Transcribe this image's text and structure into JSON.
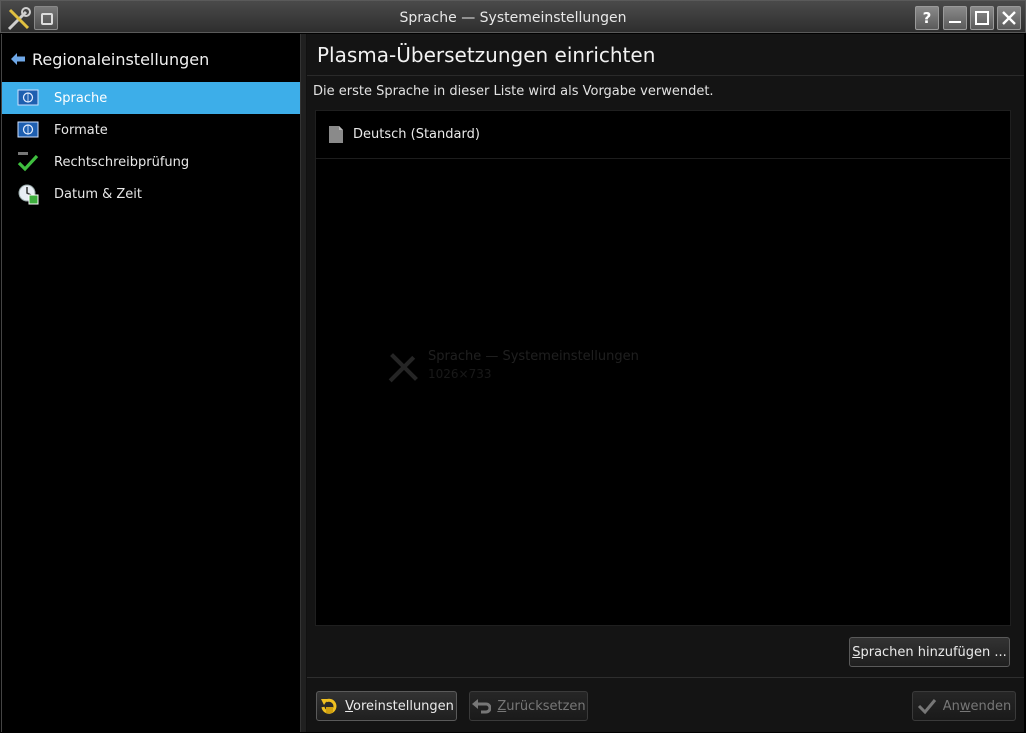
{
  "window": {
    "title": "Sprache — Systemeinstellungen",
    "help_label": "?"
  },
  "sidebar": {
    "back_label": "Regionaleinstellungen",
    "items": [
      {
        "label": "Sprache",
        "icon": "flag-icon",
        "active": true
      },
      {
        "label": "Formate",
        "icon": "flag-icon",
        "active": false
      },
      {
        "label": "Rechtschreibprüfung",
        "icon": "spellcheck-icon",
        "active": false
      },
      {
        "label": "Datum & Zeit",
        "icon": "clock-icon",
        "active": false
      }
    ]
  },
  "main": {
    "title": "Plasma-Übersetzungen einrichten",
    "description": "Die erste Sprache in dieser Liste wird als Vorgabe verwendet.",
    "languages": [
      {
        "label": "Deutsch (Standard)"
      }
    ],
    "ghost_title": "Sprache — Systemeinstellungen",
    "ghost_subtitle": "1026×733",
    "add_button": {
      "mnemonic": "S",
      "rest": "prachen hinzufügen ..."
    }
  },
  "footer": {
    "defaults": {
      "mnemonic": "V",
      "rest": "oreinstellungen"
    },
    "reset": {
      "mnemonic": "Z",
      "rest": "urücksetzen"
    },
    "apply": {
      "pre": "An",
      "mnemonic": "w",
      "rest": "enden"
    }
  },
  "colors": {
    "accent": "#3daee9",
    "background": "#000000",
    "panel": "#141414"
  }
}
